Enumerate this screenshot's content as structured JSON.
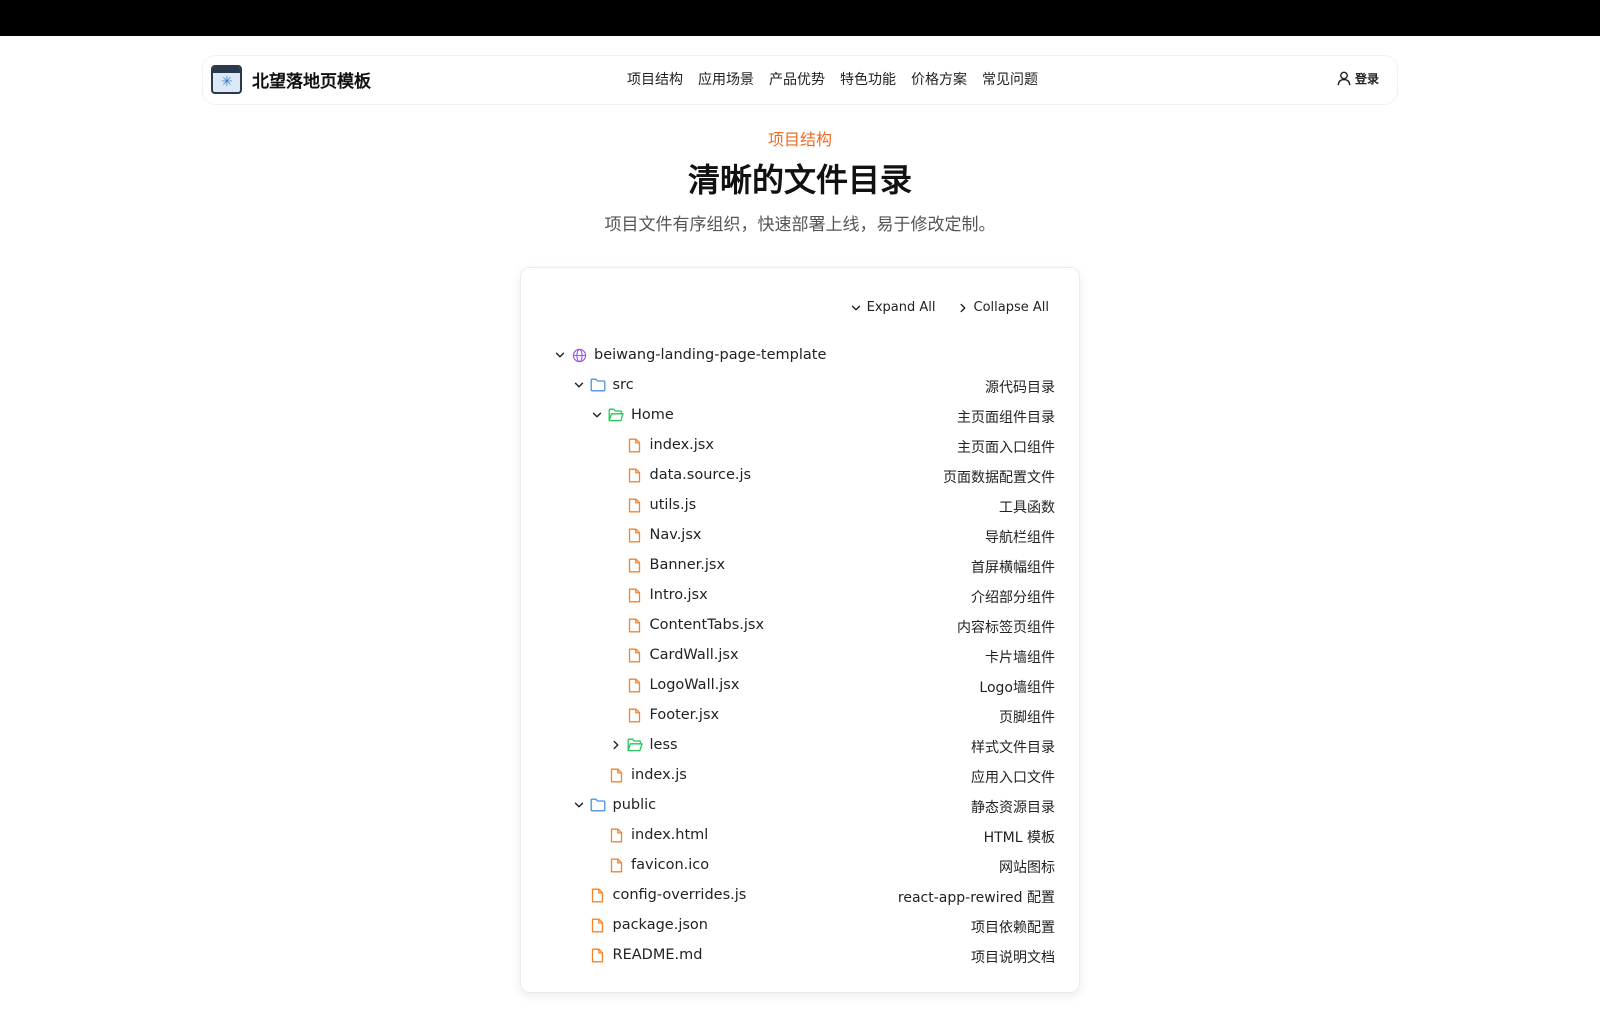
{
  "brand": {
    "name": "北望落地页模板",
    "logo_icon": "window-snowflake-logo"
  },
  "nav": {
    "links": [
      "项目结构",
      "应用场景",
      "产品优势",
      "特色功能",
      "价格方案",
      "常见问题"
    ],
    "login_label": "登录",
    "login_icon": "user-icon"
  },
  "section": {
    "eyebrow": "项目结构",
    "title": "清晰的文件目录",
    "subtitle": "项目文件有序组织，快速部署上线，易于修改定制。"
  },
  "controls": {
    "expand_all": "Expand All",
    "collapse_all": "Collapse All"
  },
  "colors": {
    "accent": "#f26a21",
    "folder_blue": "#4a90e2",
    "folder_green": "#22c55e",
    "file_orange": "#f5832a",
    "root_purple": "#9b5de5"
  },
  "tree": [
    {
      "name": "beiwang-landing-page-template",
      "desc": "",
      "depth": 0,
      "kind": "root",
      "chevron": "down"
    },
    {
      "name": "src",
      "desc": "源代码目录",
      "depth": 1,
      "kind": "folder-blue",
      "chevron": "down"
    },
    {
      "name": "Home",
      "desc": "主页面组件目录",
      "depth": 2,
      "kind": "folder-green-open",
      "chevron": "down"
    },
    {
      "name": "index.jsx",
      "desc": "主页面入口组件",
      "depth": 3,
      "kind": "file",
      "chevron": "none"
    },
    {
      "name": "data.source.js",
      "desc": "页面数据配置文件",
      "depth": 3,
      "kind": "file",
      "chevron": "none"
    },
    {
      "name": "utils.js",
      "desc": "工具函数",
      "depth": 3,
      "kind": "file",
      "chevron": "none"
    },
    {
      "name": "Nav.jsx",
      "desc": "导航栏组件",
      "depth": 3,
      "kind": "file",
      "chevron": "none"
    },
    {
      "name": "Banner.jsx",
      "desc": "首屏横幅组件",
      "depth": 3,
      "kind": "file",
      "chevron": "none"
    },
    {
      "name": "Intro.jsx",
      "desc": "介绍部分组件",
      "depth": 3,
      "kind": "file",
      "chevron": "none"
    },
    {
      "name": "ContentTabs.jsx",
      "desc": "内容标签页组件",
      "depth": 3,
      "kind": "file",
      "chevron": "none"
    },
    {
      "name": "CardWall.jsx",
      "desc": "卡片墙组件",
      "depth": 3,
      "kind": "file",
      "chevron": "none"
    },
    {
      "name": "LogoWall.jsx",
      "desc": "Logo墙组件",
      "depth": 3,
      "kind": "file",
      "chevron": "none"
    },
    {
      "name": "Footer.jsx",
      "desc": "页脚组件",
      "depth": 3,
      "kind": "file",
      "chevron": "none"
    },
    {
      "name": "less",
      "desc": "样式文件目录",
      "depth": 3,
      "kind": "folder-green-open",
      "chevron": "right"
    },
    {
      "name": "index.js",
      "desc": "应用入口文件",
      "depth": 2,
      "kind": "file",
      "chevron": "none"
    },
    {
      "name": "public",
      "desc": "静态资源目录",
      "depth": 1,
      "kind": "folder-blue",
      "chevron": "down"
    },
    {
      "name": "index.html",
      "desc": "HTML 模板",
      "depth": 2,
      "kind": "file",
      "chevron": "none"
    },
    {
      "name": "favicon.ico",
      "desc": "网站图标",
      "depth": 2,
      "kind": "file",
      "chevron": "none"
    },
    {
      "name": "config-overrides.js",
      "desc": "react-app-rewired 配置",
      "depth": 1,
      "kind": "file",
      "chevron": "none"
    },
    {
      "name": "package.json",
      "desc": "项目依赖配置",
      "depth": 1,
      "kind": "file",
      "chevron": "none"
    },
    {
      "name": "README.md",
      "desc": "项目说明文档",
      "depth": 1,
      "kind": "file",
      "chevron": "none"
    }
  ]
}
